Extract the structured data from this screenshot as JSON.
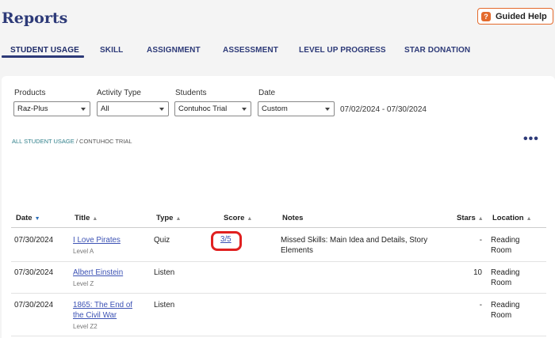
{
  "page": {
    "title": "Reports"
  },
  "help": {
    "label": "Guided Help",
    "icon": "?"
  },
  "tabs": [
    {
      "label": "STUDENT USAGE"
    },
    {
      "label": "SKILL"
    },
    {
      "label": "ASSIGNMENT"
    },
    {
      "label": "ASSESSMENT"
    },
    {
      "label": "LEVEL UP PROGRESS"
    },
    {
      "label": "STAR DONATION"
    }
  ],
  "filters": {
    "products": {
      "label": "Products",
      "value": "Raz-Plus"
    },
    "activity_type": {
      "label": "Activity Type",
      "value": "All"
    },
    "students": {
      "label": "Students",
      "value": "Contuhoc Trial"
    },
    "date": {
      "label": "Date",
      "value": "Custom"
    },
    "date_range": "07/02/2024 - 07/30/2024"
  },
  "breadcrumb": {
    "root": "ALL STUDENT USAGE",
    "separator": " / ",
    "current": "CONTUHOC TRIAL"
  },
  "more_label": "•••",
  "table": {
    "headers": {
      "date": "Date",
      "title": "Title",
      "type": "Type",
      "score": "Score",
      "notes": "Notes",
      "stars": "Stars",
      "location": "Location"
    },
    "rows": [
      {
        "date": "07/30/2024",
        "title": "I Love Pirates",
        "level": "Level A",
        "type": "Quiz",
        "score": "3/5",
        "notes": "Missed Skills: Main Idea and Details, Story Elements",
        "stars": "-",
        "location": "Reading Room"
      },
      {
        "date": "07/30/2024",
        "title": "Albert Einstein",
        "level": "Level Z",
        "type": "Listen",
        "score": "",
        "notes": "",
        "stars": "10",
        "location": "Reading Room"
      },
      {
        "date": "07/30/2024",
        "title": "1865: The End of the Civil War",
        "level": "Level Z2",
        "type": "Listen",
        "score": "",
        "notes": "",
        "stars": "-",
        "location": "Reading Room"
      }
    ]
  },
  "colors": {
    "brand": "#2d3a78",
    "help_accent": "#e46a2c",
    "link": "#3c52b4",
    "highlight": "#e02020"
  }
}
